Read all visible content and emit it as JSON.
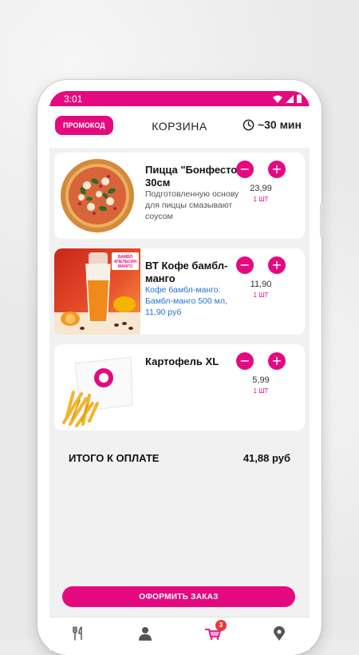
{
  "status_bar": {
    "time": "3:01"
  },
  "header": {
    "promo_label": "ПРОМОКОД",
    "title": "КОРЗИНА",
    "delivery_time": "~30 мин"
  },
  "cart": {
    "items": [
      {
        "name": "Пицца \"Бонфесто\" 30см",
        "description": "Подготовленную основу для пиццы смазывают соусом",
        "price": "23,99",
        "quantity": "1 ШТ",
        "image": "pizza"
      },
      {
        "name": "ВТ Кофе бамбл-манго",
        "description": "Кофе бамбл-манго: Бамбл-манго 500 мл, 11,90 руб",
        "price": "11,90",
        "quantity": "1 ШТ",
        "image": "mango-coffee",
        "image_label": "БАМБЛ АПЕЛЬСИН МАНГО"
      },
      {
        "name": "Картофель XL",
        "description": "",
        "price": "5,99",
        "quantity": "1 ШТ",
        "image": "fries"
      }
    ],
    "minus_symbol": "−",
    "plus_symbol": "+"
  },
  "total": {
    "label": "ИТОГО К ОПЛАТЕ",
    "value": "41,88 руб"
  },
  "order_button": "ОФОРМИТЬ ЗАКАЗ",
  "bottom_nav": {
    "items": [
      "fork-knife-icon",
      "user-icon",
      "cart-icon",
      "location-icon"
    ],
    "cart_badge": "3"
  },
  "colors": {
    "accent": "#e5097f",
    "link_blue": "#1e73d6",
    "badge_red": "#e83a3a"
  }
}
